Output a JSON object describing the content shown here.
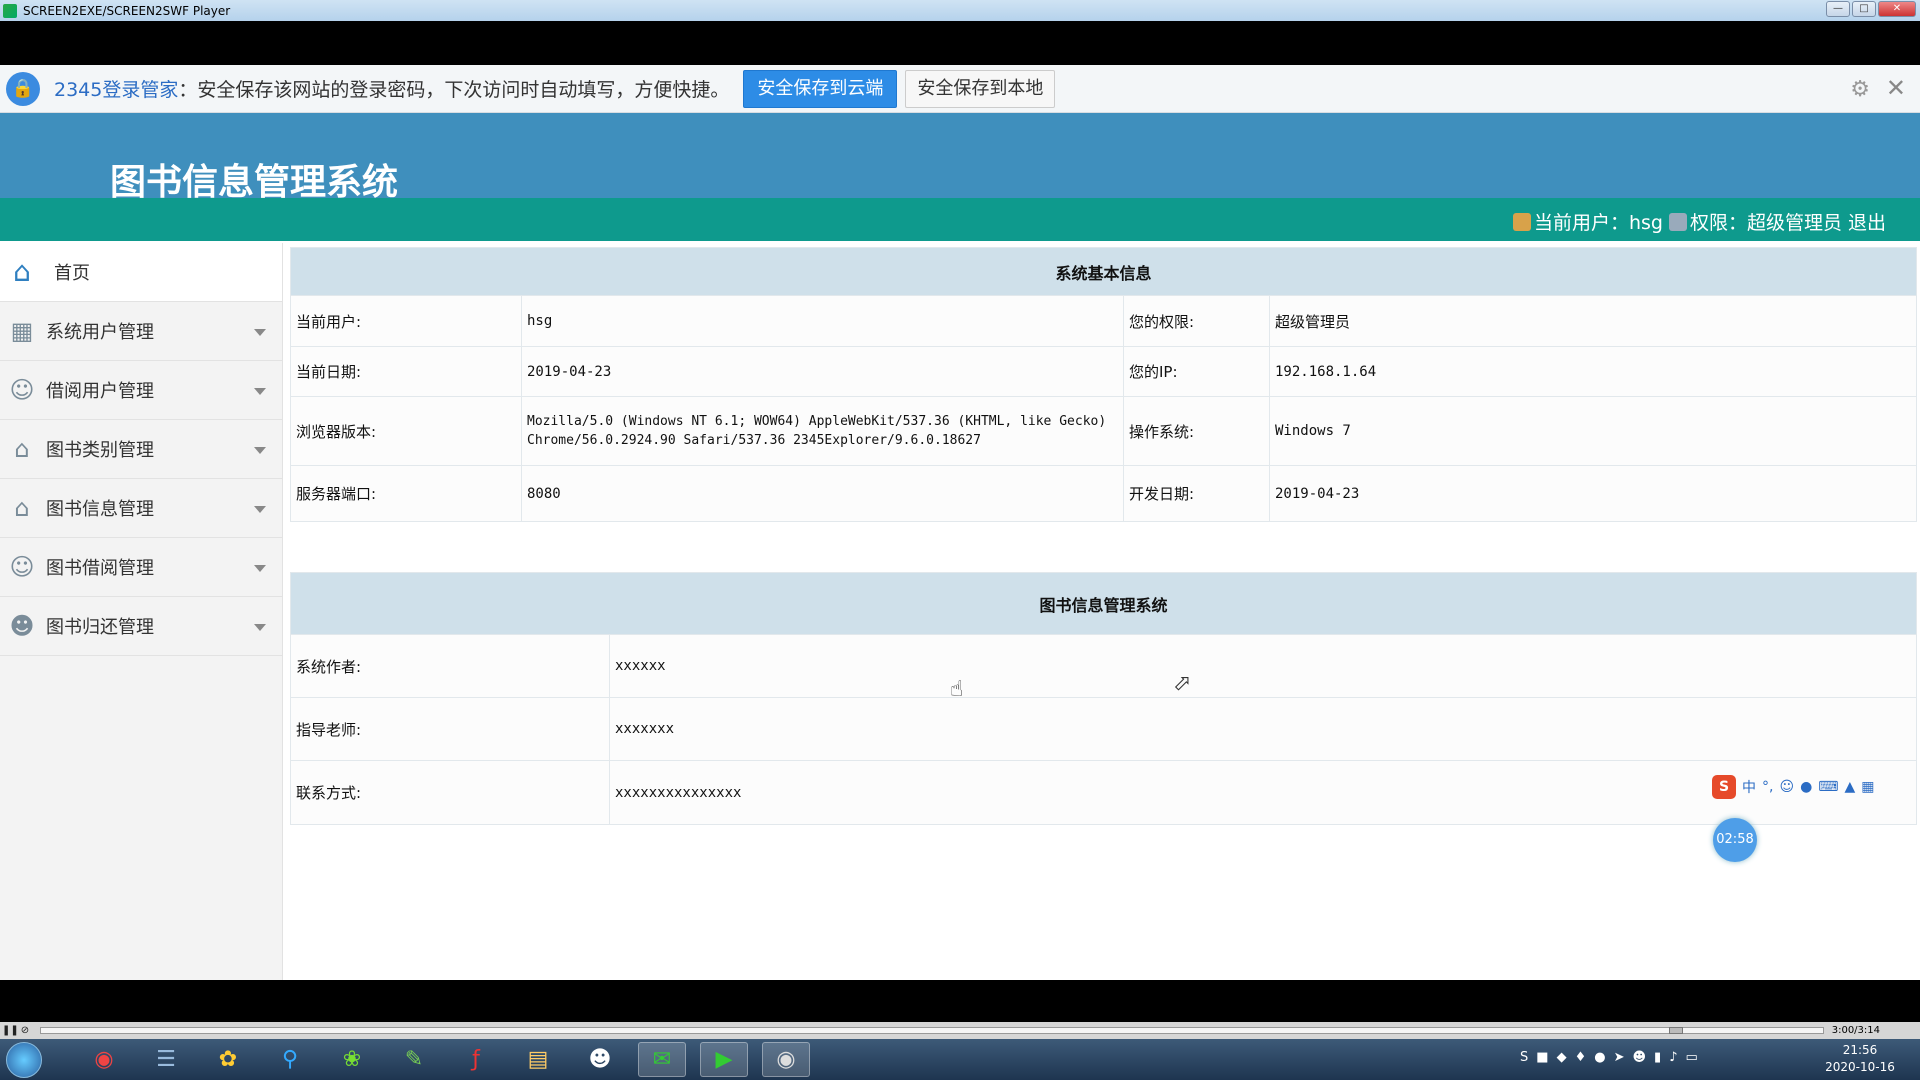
{
  "window": {
    "title": "SCREEN2EXE/SCREEN2SWF Player"
  },
  "password_bar": {
    "brand": "2345登录管家",
    "message": "：安全保存该网站的登录密码，下次访问时自动填写，方便快捷。",
    "save_cloud": "安全保存到云端",
    "save_local": "安全保存到本地",
    "icons": [
      "lock-icon",
      "gear-icon",
      "close-icon"
    ]
  },
  "app": {
    "title": "图书信息管理系统"
  },
  "userbar": {
    "user_label": "当前用户：hsg",
    "role_label": "权限：超级管理员",
    "logout": "退出"
  },
  "sidebar": {
    "items": [
      {
        "label": "首页",
        "icon": "home-icon"
      },
      {
        "label": "系统用户管理",
        "icon": "grid-icon"
      },
      {
        "label": "借阅用户管理",
        "icon": "users-icon"
      },
      {
        "label": "图书类别管理",
        "icon": "home-icon"
      },
      {
        "label": "图书信息管理",
        "icon": "home-icon"
      },
      {
        "label": "图书借阅管理",
        "icon": "users-icon"
      },
      {
        "label": "图书归还管理",
        "icon": "user-icon"
      }
    ]
  },
  "system_info": {
    "title": "系统基本信息",
    "current_user_label": "当前用户:",
    "current_user": "hsg",
    "permission_label": "您的权限:",
    "permission": "超级管理员",
    "date_label": "当前日期:",
    "date": "2019-04-23",
    "ip_label": "您的IP:",
    "ip": "192.168.1.64",
    "browser_label": "浏览器版本:",
    "browser": "Mozilla/5.0 (Windows NT 6.1; WOW64) AppleWebKit/537.36 (KHTML, like Gecko) Chrome/56.0.2924.90 Safari/537.36 2345Explorer/9.6.0.18627",
    "os_label": "操作系统:",
    "os": "Windows 7",
    "port_label": "服务器端口:",
    "port": "8080",
    "dev_date_label": "开发日期:",
    "dev_date": "2019-04-23"
  },
  "about": {
    "title": "图书信息管理系统",
    "author_label": "系统作者:",
    "author": "xxxxxx",
    "teacher_label": "指导老师:",
    "teacher": "xxxxxxx",
    "contact_label": "联系方式:",
    "contact": "xxxxxxxxxxxxxxx"
  },
  "overlay": {
    "ime_label": "中",
    "timer": "02:58"
  },
  "player": {
    "time": "3:00/3:14",
    "progress": 0.921
  },
  "taskbar": {
    "time": "21:56",
    "date": "2020-10-16"
  }
}
